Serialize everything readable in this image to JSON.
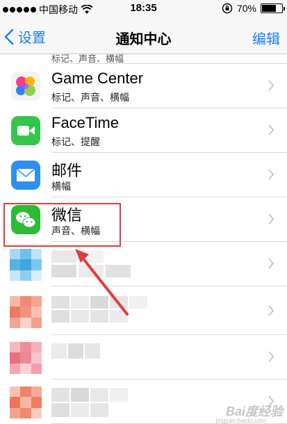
{
  "status_bar": {
    "carrier": "中国移动",
    "time": "18:35",
    "battery_text": "70%",
    "battery_level": 0.7,
    "signal_bars_filled": 5
  },
  "nav": {
    "back_label": "设置",
    "title": "通知中心",
    "edit_label": "编辑"
  },
  "list": {
    "partial_row_text": "标记、声音、横幅",
    "apps": [
      {
        "name": "Game Center",
        "subtitle": "标记、声音、横幅",
        "icon": "game-center-icon"
      },
      {
        "name": "FaceTime",
        "subtitle": "标记、提醒",
        "icon": "facetime-icon"
      },
      {
        "name": "邮件",
        "subtitle": "横幅",
        "icon": "mail-icon"
      },
      {
        "name": "微信",
        "subtitle": "声音、横幅",
        "icon": "wechat-icon"
      }
    ]
  },
  "colors": {
    "accent": "#1a7ff5",
    "highlight": "#e23b3b",
    "wechat_green": "#2bbb34"
  },
  "watermark": {
    "text": "Bai度经验",
    "sub": "jingyan.baidu.com"
  }
}
